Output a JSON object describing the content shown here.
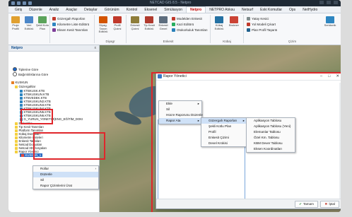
{
  "quick_access": [
    "save-icon",
    "undo-icon",
    "redo-icon",
    "print-icon"
  ],
  "window_title": "NETCAD GIS 8.5 - Netpro",
  "menu": [
    "Giriş",
    "Düzenle",
    "Analiz",
    "Araçlar",
    "Detaylar",
    "Görünüm",
    "Kontrol",
    "Eksenel",
    "Simülasyon",
    "Netpro",
    "NETPRO Atıksu",
    "Netsurf",
    "Eski Komutlar",
    "Ops",
    "NetHydro"
  ],
  "menu_active_index": 9,
  "ribbon": {
    "b_proje": "Proje\nProfili",
    "b_veri": "Veri\nEditörü",
    "b_sekil": "Şekil Kotu\nPlan",
    "s_gozergah_rap": "Gözergah Raporları",
    "s_kilometre": "Kilometre Liste Editörü",
    "s_eksen_kesit": "Eksen Kesit Tanımları",
    "b_diyagram": "Diyag. Tanım\nEditörü",
    "b_profil_cizimi": "Profil\nÇizimi",
    "g_diyagram": "Diyagr",
    "b_enkesit": "Enkesit\nÇizimi",
    "b_tip_kesit": "Tip Kesit\nEditörü",
    "b_enkesit_genel": "Enkesit\nGenel",
    "s_modelden": "Modelden Enkesit",
    "s_kazi": "Kazi Editörü",
    "s_otokorkuluk": "Otokorkuluk Tanımları",
    "g_enkesit": "Enkesit",
    "b_kubaj": "Kübaj\nEditörü",
    "b_brukner": "Brukner",
    "g_kubaj": "Kübaj",
    "s_yatay": "Yatay Kesici",
    "s_yol_modeli": "Yol Modeli Çıkart",
    "s_plan_profil": "Plan Profil Taşarıtı",
    "b_seridonik": "Seridonik",
    "g_cizim": "Çizim"
  },
  "left_panel": {
    "title": "Netpro",
    "close": "x",
    "radio1": "Tiplerine Göre",
    "radio2": "Bağımlılıklarına Göre",
    "tree": [
      "KUSKUN",
      "Güzergahlar",
      "KTBKUSK.KTB",
      "KTBKUSKUN.KTB",
      "KTBVEDEK.KTB",
      "KTBKUSKUN2.KTB",
      "KTBKUSKUN3.KTB",
      "KTBKUSKUN4.KTB",
      "KTBKUSKUN5.KTB",
      "KTBKUSKUN6.KTB",
      "G_YURUN_YONETIM(ENG_EĞİTİM_DOKI",
      "Enkesitler",
      "Tip Kesit Tanımları",
      "Platform Tanımları",
      "Kübaj Dosyaları",
      "Kilometre Listeleri",
      "Enkesit Tabloları",
      "Netcad Dosyaları",
      "Netcad 3D Dosyaları",
      "Rapor Yönetici",
      "KUSKUN_1"
    ]
  },
  "context_left": [
    "Rollar",
    "Düzenle",
    "Sil",
    "Rapor Çizimlerini Ürat"
  ],
  "context_left_arrow": "›",
  "dialog": {
    "title": "Rapor Yönetici",
    "min": "–",
    "max": "□",
    "close": "✕",
    "ok": "Tamam",
    "cancel": "İptal"
  },
  "ctx_main": [
    "Ekle",
    "Sil",
    "Hücre Raporunu Düzenle",
    "Rapor Ata"
  ],
  "ctx_sub": [
    "Gözergah Raporları",
    "Şekli Kotlu Plan",
    "Profil",
    "Enkesit Çizimi",
    "Devel Krokisi"
  ],
  "ctx_sub2": [
    "Aplikasyon Tablosu",
    "Aplikasyon Tablosu (Yeni)",
    "Elemanlar Tablosu",
    "Özel Km. Tablosu",
    "KBM Dever Tablosu",
    "Eksen Koordinatları"
  ],
  "arrow": "▸"
}
